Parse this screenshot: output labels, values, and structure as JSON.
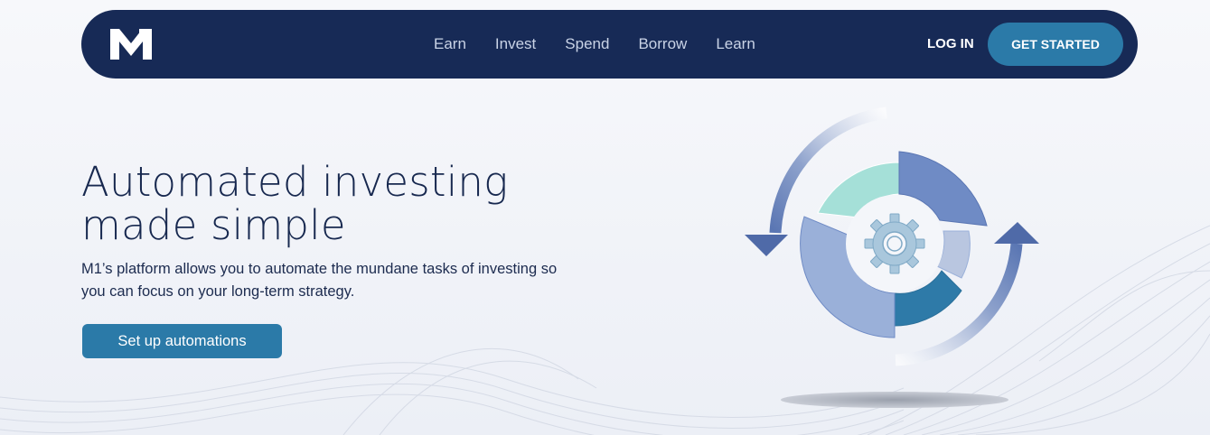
{
  "brand": {
    "logo_text": "M1"
  },
  "nav": {
    "links": [
      {
        "label": "Earn"
      },
      {
        "label": "Invest"
      },
      {
        "label": "Spend"
      },
      {
        "label": "Borrow"
      },
      {
        "label": "Learn"
      }
    ],
    "login_label": "LOG IN",
    "get_started_label": "GET STARTED"
  },
  "hero": {
    "title_line1": "Automated investing",
    "title_line2": "made simple",
    "description_line1": "M1’s platform allows you to automate the mundane tasks of investing so",
    "description_line2": "you can focus on your long-term strategy.",
    "cta_label": "Set up automations"
  },
  "illustration": {
    "icons": [
      "gear-icon",
      "rotate-arrows-icon",
      "donut-chart"
    ]
  },
  "colors": {
    "nav_bg": "#172a56",
    "accent": "#2b7aa8",
    "text_dark": "#17284f",
    "nav_text": "#c9d3e6",
    "teal": "#a5e0d8",
    "blue_dark": "#6f8bc5",
    "blue_mid": "#9ab0d9",
    "blue_light": "#b9c6e0",
    "blue_teal": "#2e7aa8"
  }
}
